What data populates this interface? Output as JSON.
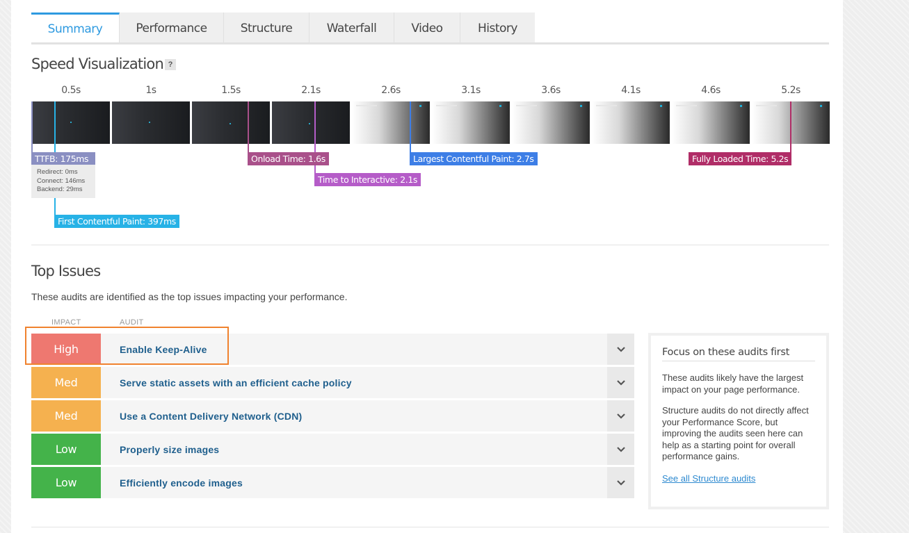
{
  "tabs": [
    "Summary",
    "Performance",
    "Structure",
    "Waterfall",
    "Video",
    "History"
  ],
  "speed_viz": {
    "title": "Speed Visualization",
    "help": "?",
    "time_labels": [
      "0.5s",
      "1s",
      "1.5s",
      "2.1s",
      "2.6s",
      "3.1s",
      "3.6s",
      "4.1s",
      "4.6s",
      "5.2s"
    ],
    "markers": {
      "ttfb": "TTFB: 175ms",
      "onload": "Onload Time: 1.6s",
      "tti": "Time to Interactive: 2.1s",
      "lcp": "Largest Contentful Paint: 2.7s",
      "fully_loaded": "Fully Loaded Time: 5.2s",
      "fcp": "First Contentful Paint: 397ms"
    },
    "ttfb_details": [
      "Redirect: 0ms",
      "Connect: 146ms",
      "Backend: 29ms"
    ]
  },
  "top_issues": {
    "title": "Top Issues",
    "description": "These audits are identified as the top issues impacting your performance.",
    "col_impact": "IMPACT",
    "col_audit": "AUDIT",
    "audits": [
      {
        "impact": "High",
        "level": "high",
        "title": "Enable Keep-Alive"
      },
      {
        "impact": "Med",
        "level": "med",
        "title": "Serve static assets with an efficient cache policy"
      },
      {
        "impact": "Med",
        "level": "med",
        "title": "Use a Content Delivery Network (CDN)"
      },
      {
        "impact": "Low",
        "level": "low",
        "title": "Properly size images"
      },
      {
        "impact": "Low",
        "level": "low",
        "title": "Efficiently encode images"
      }
    ]
  },
  "focus": {
    "title": "Focus on these audits first",
    "p1": "These audits likely have the largest impact on your page performance.",
    "p2": "Structure audits do not directly affect your Performance Score, but improving the audits seen here can help as a starting point for overall performance gains.",
    "link": "See all Structure audits"
  },
  "colors": {
    "accent": "#2e9ae0",
    "impact_high": "#ee7870",
    "impact_med": "#f5b14f",
    "impact_low": "#44b34a",
    "highlight": "#f0822e",
    "marker_ttfb": "#8a8fc2",
    "marker_onload": "#a9508a",
    "marker_tti": "#b55cc8",
    "marker_lcp": "#3d7ee6",
    "marker_fully_loaded": "#b02d67",
    "marker_fcp": "#27b2e6"
  }
}
